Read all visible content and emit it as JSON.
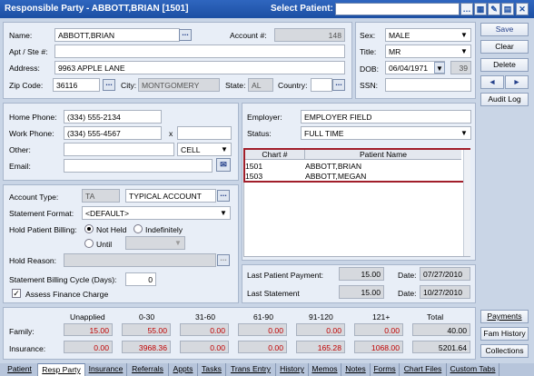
{
  "title": "Responsible Party - ABBOTT,BRIAN [1501]",
  "select_patient_label": "Select Patient:",
  "name": {
    "label": "Name:",
    "value": "ABBOTT,BRIAN"
  },
  "account": {
    "label": "Account #:",
    "value": "148"
  },
  "apt": {
    "label": "Apt / Ste #:",
    "value": ""
  },
  "address": {
    "label": "Address:",
    "value": "9963 APPLE LANE"
  },
  "zip": {
    "label": "Zip Code:",
    "value": "36116"
  },
  "city": {
    "label": "City:",
    "value": "MONTGOMERY"
  },
  "state": {
    "label": "State:",
    "value": "AL"
  },
  "country": {
    "label": "Country:",
    "value": ""
  },
  "sex": {
    "label": "Sex:",
    "value": "MALE"
  },
  "title_field": {
    "label": "Title:",
    "value": "MR"
  },
  "dob": {
    "label": "DOB:",
    "value": "06/04/1971",
    "age": "39"
  },
  "ssn": {
    "label": "SSN:",
    "value": ""
  },
  "buttons": {
    "save": "Save",
    "clear": "Clear",
    "delete": "Delete",
    "prev": "◄",
    "next": "►",
    "audit": "Audit Log",
    "payments": "Payments",
    "fam_history": "Fam History",
    "collections": "Collections"
  },
  "home_phone": {
    "label": "Home Phone:",
    "value": "(334) 555-2134"
  },
  "work_phone": {
    "label": "Work Phone:",
    "value": "(334) 555-4567",
    "ext_label": "x",
    "ext": ""
  },
  "other": {
    "label": "Other:",
    "value": "",
    "type": "CELL"
  },
  "email": {
    "label": "Email:",
    "value": ""
  },
  "employer": {
    "label": "Employer:",
    "value": "EMPLOYER FIELD"
  },
  "status": {
    "label": "Status:",
    "value": "FULL TIME"
  },
  "patients": {
    "headers": [
      "Chart #",
      "Patient Name"
    ],
    "rows": [
      [
        "1501",
        "ABBOTT,BRIAN"
      ],
      [
        "1503",
        "ABBOTT,MEGAN"
      ]
    ]
  },
  "account_type": {
    "label": "Account Type:",
    "code": "TA",
    "value": "TYPICAL ACCOUNT"
  },
  "statement_format": {
    "label": "Statement Format:",
    "value": "<DEFAULT>"
  },
  "hold_billing": {
    "label": "Hold Patient Billing:",
    "not_held": "Not Held",
    "indefinitely": "Indefinitely",
    "until": "Until"
  },
  "hold_reason": {
    "label": "Hold Reason:"
  },
  "cycle": {
    "label": "Statement Billing Cycle (Days):",
    "value": "0"
  },
  "assess": {
    "label": "Assess Finance Charge",
    "checked": true
  },
  "last_payment": {
    "label": "Last Patient Payment:",
    "amount": "15.00",
    "date_label": "Date:",
    "date": "07/27/2010"
  },
  "last_statement": {
    "label": "Last Statement",
    "amount": "15.00",
    "date_label": "Date:",
    "date": "10/27/2010"
  },
  "aging": {
    "headers": [
      "Unapplied",
      "0-30",
      "31-60",
      "61-90",
      "91-120",
      "121+",
      "Total"
    ],
    "rows": [
      {
        "label": "Family:",
        "values": [
          "15.00",
          "55.00",
          "0.00",
          "0.00",
          "0.00",
          "0.00",
          "40.00"
        ]
      },
      {
        "label": "Insurance:",
        "values": [
          "0.00",
          "3968.36",
          "0.00",
          "0.00",
          "165.28",
          "1068.00",
          "5201.64"
        ]
      }
    ]
  },
  "tabs": [
    "Patient",
    "Resp Party",
    "Insurance",
    "Referrals",
    "Appts",
    "Tasks",
    "Trans Entry",
    "History",
    "Memos",
    "Notes",
    "Forms",
    "Chart Files",
    "Custom Tabs"
  ]
}
